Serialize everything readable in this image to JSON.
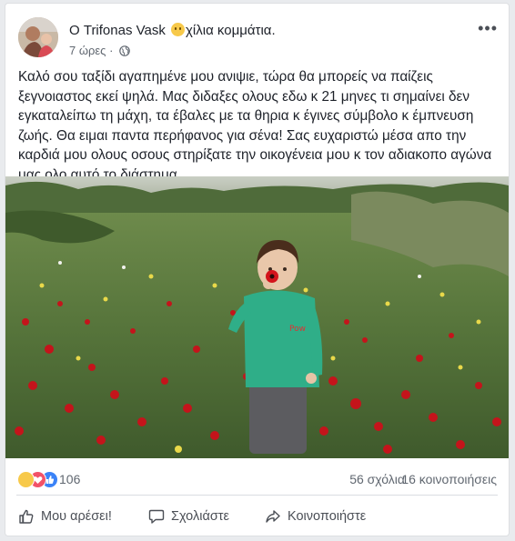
{
  "post": {
    "author": "Ο Trifonas Vask",
    "feeling": "χίλια κομμάτια.",
    "feeling_icon": "sad-face-icon",
    "time": "7 ώρες",
    "audience_icon": "globe-icon",
    "text": "Καλό σου ταξίδι αγαπημένε μου ανιψιε, τώρα θα μπορείς να παίζεις ξεγνοιαστος εκεί ψηλά.   Μας διδαξες ολους εδω κ 21 μηνες τι σημαίνει δεν εγκαταλείπω τη μάχη, τα έβαλες με τα θηρια κ έγινες σύμβολο κ έμπνευση ζωής. Θα ειμαι παντα περήφανος για σένα! Σας ευχαριστώ μέσα απο την καρδιά μου ολους οσους στηρίξατε την οικογένεια μου κ τον αδιακοπο αγώνα μας ολο αυτό το διάστημα.",
    "photo_subject": "child holding a red poppy in a flower field"
  },
  "stats": {
    "reactions": "106",
    "comments": "56 σχόλια",
    "shares": "16 κοινοποιήσεις"
  },
  "actions": {
    "like": "Μου αρέσει!",
    "comment": "Σχολιάστε",
    "share": "Κοινοποιήστε"
  },
  "colors": {
    "like_blue": "#3b83f7",
    "love_red": "#f25268",
    "sad_yellow": "#f7c94a",
    "meta_gray": "#606770"
  }
}
